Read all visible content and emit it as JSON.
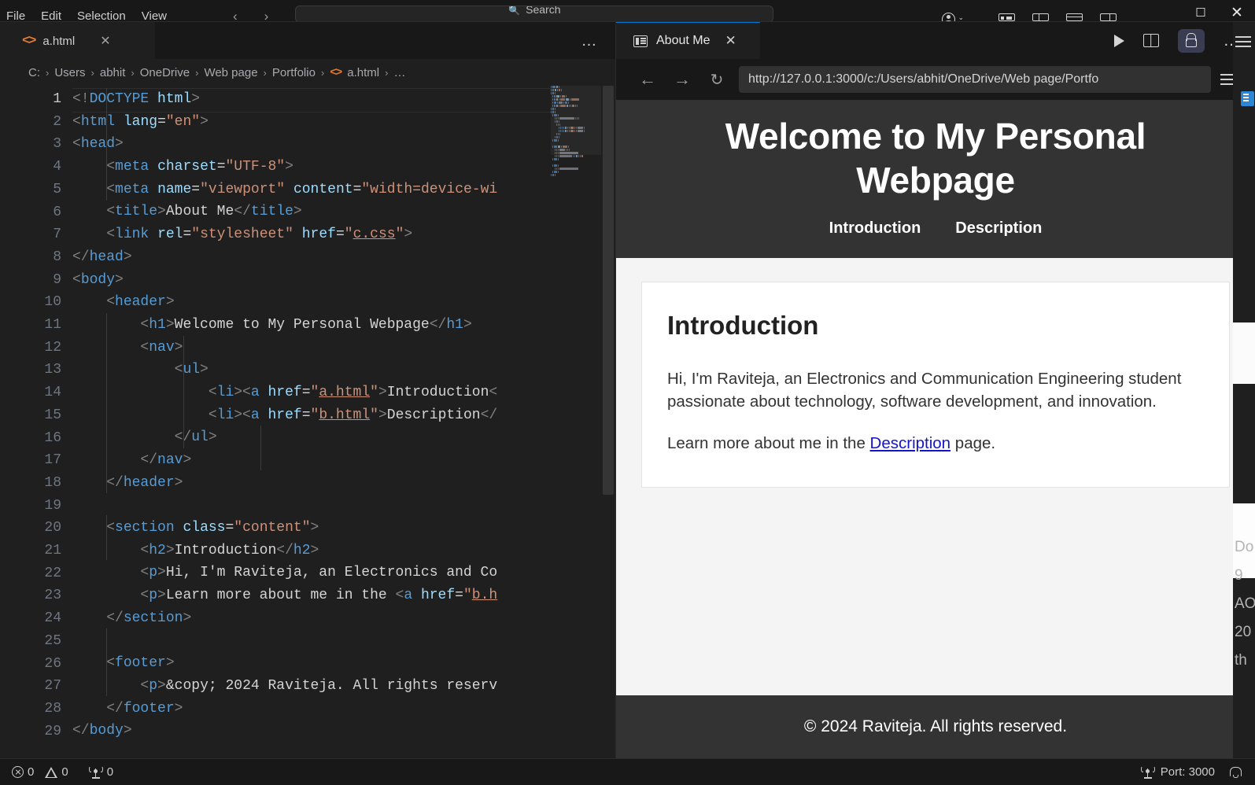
{
  "titlebar": {
    "menus": [
      "File",
      "Edit",
      "Selection",
      "View"
    ],
    "back_arrow": "‹",
    "forward_arrow": "›",
    "search": {
      "icon": "search-icon",
      "placeholder": "Search"
    },
    "account_caret": "⌄",
    "layout_icons": [
      "customize-layout-icon",
      "toggle-primary-sidebar-icon",
      "toggle-panel-icon",
      "toggle-secondary-sidebar-icon"
    ],
    "window_controls": {
      "minimize": "—",
      "maximize": "☐",
      "close": "✕"
    }
  },
  "editor": {
    "tab": {
      "name": "a.html",
      "icon": "html-file-icon",
      "close": "✕"
    },
    "tab_actions": "…",
    "breadcrumb": [
      "C:",
      "Users",
      "abhit",
      "OneDrive",
      "Web page",
      "Portfolio",
      "a.html",
      "…"
    ],
    "breadcrumb_separator": "›",
    "line_numbers": [
      1,
      2,
      3,
      4,
      5,
      6,
      7,
      8,
      9,
      10,
      11,
      12,
      13,
      14,
      15,
      16,
      17,
      18,
      19,
      20,
      21,
      22,
      23,
      24,
      25,
      26,
      27,
      28,
      29
    ],
    "code_lines": [
      {
        "n": 1,
        "tokens": [
          [
            "t-punct",
            "<!"
          ],
          [
            "t-doct",
            "DOCTYPE"
          ],
          [
            "t-txt",
            " "
          ],
          [
            "t-doctn",
            "html"
          ],
          [
            "t-punct",
            ">"
          ]
        ]
      },
      {
        "n": 2,
        "tokens": [
          [
            "t-punct",
            "<"
          ],
          [
            "t-tag",
            "html"
          ],
          [
            "t-txt",
            " "
          ],
          [
            "t-attr",
            "lang"
          ],
          [
            "t-eq",
            "="
          ],
          [
            "t-str",
            "\"en\""
          ],
          [
            "t-punct",
            ">"
          ]
        ]
      },
      {
        "n": 3,
        "tokens": [
          [
            "t-punct",
            "<"
          ],
          [
            "t-tag",
            "head"
          ],
          [
            "t-punct",
            ">"
          ]
        ]
      },
      {
        "n": 4,
        "tokens": [
          [
            "t-txt",
            "    "
          ],
          [
            "t-punct",
            "<"
          ],
          [
            "t-tag",
            "meta"
          ],
          [
            "t-txt",
            " "
          ],
          [
            "t-attr",
            "charset"
          ],
          [
            "t-eq",
            "="
          ],
          [
            "t-str",
            "\"UTF-8\""
          ],
          [
            "t-punct",
            ">"
          ]
        ]
      },
      {
        "n": 5,
        "tokens": [
          [
            "t-txt",
            "    "
          ],
          [
            "t-punct",
            "<"
          ],
          [
            "t-tag",
            "meta"
          ],
          [
            "t-txt",
            " "
          ],
          [
            "t-attr",
            "name"
          ],
          [
            "t-eq",
            "="
          ],
          [
            "t-str",
            "\"viewport\""
          ],
          [
            "t-txt",
            " "
          ],
          [
            "t-attr",
            "content"
          ],
          [
            "t-eq",
            "="
          ],
          [
            "t-str",
            "\"width=device-wi"
          ]
        ]
      },
      {
        "n": 6,
        "tokens": [
          [
            "t-txt",
            "    "
          ],
          [
            "t-punct",
            "<"
          ],
          [
            "t-tag",
            "title"
          ],
          [
            "t-punct",
            ">"
          ],
          [
            "t-txt",
            "About Me"
          ],
          [
            "t-punct",
            "</"
          ],
          [
            "t-tag",
            "title"
          ],
          [
            "t-punct",
            ">"
          ]
        ]
      },
      {
        "n": 7,
        "tokens": [
          [
            "t-txt",
            "    "
          ],
          [
            "t-punct",
            "<"
          ],
          [
            "t-tag",
            "link"
          ],
          [
            "t-txt",
            " "
          ],
          [
            "t-attr",
            "rel"
          ],
          [
            "t-eq",
            "="
          ],
          [
            "t-str",
            "\"stylesheet\""
          ],
          [
            "t-txt",
            " "
          ],
          [
            "t-attr",
            "href"
          ],
          [
            "t-eq",
            "="
          ],
          [
            "t-str",
            "\""
          ],
          [
            "t-link",
            "c.css"
          ],
          [
            "t-str",
            "\""
          ],
          [
            "t-punct",
            ">"
          ]
        ]
      },
      {
        "n": 8,
        "tokens": [
          [
            "t-punct",
            "</"
          ],
          [
            "t-tag",
            "head"
          ],
          [
            "t-punct",
            ">"
          ]
        ]
      },
      {
        "n": 9,
        "tokens": [
          [
            "t-punct",
            "<"
          ],
          [
            "t-tag",
            "body"
          ],
          [
            "t-punct",
            ">"
          ]
        ]
      },
      {
        "n": 10,
        "tokens": [
          [
            "t-txt",
            "    "
          ],
          [
            "t-punct",
            "<"
          ],
          [
            "t-tag",
            "header"
          ],
          [
            "t-punct",
            ">"
          ]
        ]
      },
      {
        "n": 11,
        "tokens": [
          [
            "t-txt",
            "        "
          ],
          [
            "t-punct",
            "<"
          ],
          [
            "t-tag",
            "h1"
          ],
          [
            "t-punct",
            ">"
          ],
          [
            "t-txt",
            "Welcome to My Personal Webpage"
          ],
          [
            "t-punct",
            "</"
          ],
          [
            "t-tag",
            "h1"
          ],
          [
            "t-punct",
            ">"
          ]
        ]
      },
      {
        "n": 12,
        "tokens": [
          [
            "t-txt",
            "        "
          ],
          [
            "t-punct",
            "<"
          ],
          [
            "t-tag",
            "nav"
          ],
          [
            "t-punct",
            ">"
          ]
        ]
      },
      {
        "n": 13,
        "tokens": [
          [
            "t-txt",
            "            "
          ],
          [
            "t-punct",
            "<"
          ],
          [
            "t-tag",
            "ul"
          ],
          [
            "t-punct",
            ">"
          ]
        ]
      },
      {
        "n": 14,
        "tokens": [
          [
            "t-txt",
            "                "
          ],
          [
            "t-punct",
            "<"
          ],
          [
            "t-tag",
            "li"
          ],
          [
            "t-punct",
            "><"
          ],
          [
            "t-tag",
            "a"
          ],
          [
            "t-txt",
            " "
          ],
          [
            "t-attr",
            "href"
          ],
          [
            "t-eq",
            "="
          ],
          [
            "t-str",
            "\""
          ],
          [
            "t-link",
            "a.html"
          ],
          [
            "t-str",
            "\""
          ],
          [
            "t-punct",
            ">"
          ],
          [
            "t-txt",
            "Introduction"
          ],
          [
            "t-punct",
            "<"
          ]
        ]
      },
      {
        "n": 15,
        "tokens": [
          [
            "t-txt",
            "                "
          ],
          [
            "t-punct",
            "<"
          ],
          [
            "t-tag",
            "li"
          ],
          [
            "t-punct",
            "><"
          ],
          [
            "t-tag",
            "a"
          ],
          [
            "t-txt",
            " "
          ],
          [
            "t-attr",
            "href"
          ],
          [
            "t-eq",
            "="
          ],
          [
            "t-str",
            "\""
          ],
          [
            "t-link",
            "b.html"
          ],
          [
            "t-str",
            "\""
          ],
          [
            "t-punct",
            ">"
          ],
          [
            "t-txt",
            "Description"
          ],
          [
            "t-punct",
            "</"
          ]
        ]
      },
      {
        "n": 16,
        "tokens": [
          [
            "t-txt",
            "            "
          ],
          [
            "t-punct",
            "</"
          ],
          [
            "t-tag",
            "ul"
          ],
          [
            "t-punct",
            ">"
          ]
        ]
      },
      {
        "n": 17,
        "tokens": [
          [
            "t-txt",
            "        "
          ],
          [
            "t-punct",
            "</"
          ],
          [
            "t-tag",
            "nav"
          ],
          [
            "t-punct",
            ">"
          ]
        ]
      },
      {
        "n": 18,
        "tokens": [
          [
            "t-txt",
            "    "
          ],
          [
            "t-punct",
            "</"
          ],
          [
            "t-tag",
            "header"
          ],
          [
            "t-punct",
            ">"
          ]
        ]
      },
      {
        "n": 19,
        "tokens": [
          [
            "t-txt",
            ""
          ]
        ]
      },
      {
        "n": 20,
        "tokens": [
          [
            "t-txt",
            "    "
          ],
          [
            "t-punct",
            "<"
          ],
          [
            "t-tag",
            "section"
          ],
          [
            "t-txt",
            " "
          ],
          [
            "t-attr",
            "class"
          ],
          [
            "t-eq",
            "="
          ],
          [
            "t-str",
            "\"content\""
          ],
          [
            "t-punct",
            ">"
          ]
        ]
      },
      {
        "n": 21,
        "tokens": [
          [
            "t-txt",
            "        "
          ],
          [
            "t-punct",
            "<"
          ],
          [
            "t-tag",
            "h2"
          ],
          [
            "t-punct",
            ">"
          ],
          [
            "t-txt",
            "Introduction"
          ],
          [
            "t-punct",
            "</"
          ],
          [
            "t-tag",
            "h2"
          ],
          [
            "t-punct",
            ">"
          ]
        ]
      },
      {
        "n": 22,
        "tokens": [
          [
            "t-txt",
            "        "
          ],
          [
            "t-punct",
            "<"
          ],
          [
            "t-tag",
            "p"
          ],
          [
            "t-punct",
            ">"
          ],
          [
            "t-txt",
            "Hi, I'm Raviteja, an Electronics and Co"
          ]
        ]
      },
      {
        "n": 23,
        "tokens": [
          [
            "t-txt",
            "        "
          ],
          [
            "t-punct",
            "<"
          ],
          [
            "t-tag",
            "p"
          ],
          [
            "t-punct",
            ">"
          ],
          [
            "t-txt",
            "Learn more about me in the "
          ],
          [
            "t-punct",
            "<"
          ],
          [
            "t-tag",
            "a"
          ],
          [
            "t-txt",
            " "
          ],
          [
            "t-attr",
            "href"
          ],
          [
            "t-eq",
            "="
          ],
          [
            "t-str",
            "\""
          ],
          [
            "t-link",
            "b.h"
          ]
        ]
      },
      {
        "n": 24,
        "tokens": [
          [
            "t-txt",
            "    "
          ],
          [
            "t-punct",
            "</"
          ],
          [
            "t-tag",
            "section"
          ],
          [
            "t-punct",
            ">"
          ]
        ]
      },
      {
        "n": 25,
        "tokens": [
          [
            "t-txt",
            ""
          ]
        ]
      },
      {
        "n": 26,
        "tokens": [
          [
            "t-txt",
            "    "
          ],
          [
            "t-punct",
            "<"
          ],
          [
            "t-tag",
            "footer"
          ],
          [
            "t-punct",
            ">"
          ]
        ]
      },
      {
        "n": 27,
        "tokens": [
          [
            "t-txt",
            "        "
          ],
          [
            "t-punct",
            "<"
          ],
          [
            "t-tag",
            "p"
          ],
          [
            "t-punct",
            ">"
          ],
          [
            "t-txt",
            "&copy; 2024 Raviteja. All rights reserv"
          ]
        ]
      },
      {
        "n": 28,
        "tokens": [
          [
            "t-txt",
            "    "
          ],
          [
            "t-punct",
            "</"
          ],
          [
            "t-tag",
            "footer"
          ],
          [
            "t-punct",
            ">"
          ]
        ]
      },
      {
        "n": 29,
        "tokens": [
          [
            "t-punct",
            "</"
          ],
          [
            "t-tag",
            "body"
          ],
          [
            "t-punct",
            ">"
          ]
        ]
      }
    ]
  },
  "preview": {
    "tab": {
      "name": "About Me",
      "icon": "browser-preview-icon",
      "close": "✕"
    },
    "actions": {
      "play": "run-icon",
      "split": "split-view-icon",
      "lock": "lock-icon",
      "more": "…"
    },
    "toolbar": {
      "back": "←",
      "forward": "→",
      "reload": "↻",
      "url": "http://127.0.0.1:3000/c:/Users/abhit/OneDrive/Web page/Portfo",
      "menu": "browser-menu-icon"
    }
  },
  "webpage": {
    "title": "Welcome to My Personal Webpage",
    "nav": [
      {
        "label": "Introduction",
        "href": "a.html"
      },
      {
        "label": "Description",
        "href": "b.html"
      }
    ],
    "section": {
      "heading": "Introduction",
      "paragraph1": "Hi, I'm Raviteja, an Electronics and Communication Engineering student passionate about technology, software development, and innovation.",
      "paragraph2_before": "Learn more about me in the ",
      "paragraph2_link": "Description",
      "paragraph2_after": " page."
    },
    "footer": "© 2024 Raviteja. All rights reserved.",
    "colors": {
      "header_bg": "#333333",
      "page_bg": "#f4f4f4",
      "card_bg": "#ffffff",
      "link": "#1414cc"
    }
  },
  "right_sliver": {
    "lines": [
      "Do",
      "9",
      "AO",
      "20",
      "th"
    ]
  },
  "statusbar": {
    "errors": {
      "icon": "error-icon",
      "count": "0"
    },
    "warnings": {
      "icon": "warning-icon",
      "count": "0"
    },
    "ports_left": {
      "icon": "radio-tower-icon",
      "count": "0"
    },
    "port": {
      "icon": "radio-tower-icon",
      "label": "Port: 3000"
    },
    "notifications": {
      "icon": "bell-icon"
    }
  }
}
